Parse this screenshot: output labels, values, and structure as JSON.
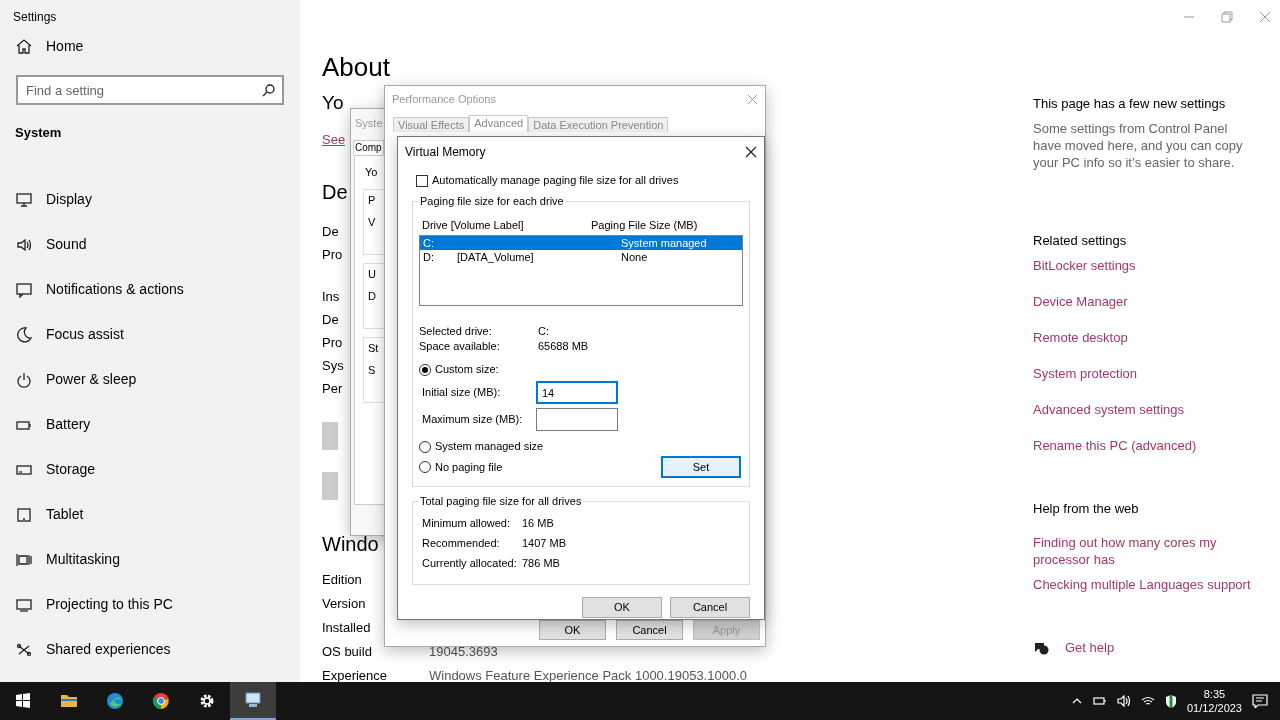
{
  "settings": {
    "title": "Settings",
    "home": "Home",
    "search": {
      "placeholder": "Find a setting"
    },
    "section": "System",
    "nav": [
      "Display",
      "Sound",
      "Notifications & actions",
      "Focus assist",
      "Power & sleep",
      "Battery",
      "Storage",
      "Tablet",
      "Multitasking",
      "Projecting to this PC",
      "Shared experiences"
    ]
  },
  "about": {
    "title": "About",
    "subtitle": "Yo",
    "link": "See",
    "device_heading": "De",
    "device_rows": [
      "De",
      "Pro",
      "Ins",
      "De",
      "Pro",
      "Sys",
      "Per"
    ],
    "windows_heading": "Windo",
    "windows_rows": [
      {
        "label": "Edition"
      },
      {
        "label": "Version"
      },
      {
        "label": "Installed"
      },
      {
        "label": "OS build",
        "value": "19045.3693"
      },
      {
        "label": "Experience",
        "value": "Windows Feature Experience Pack 1000.19053.1000.0"
      }
    ]
  },
  "side_panel": {
    "notice_title": "This page has a few new settings",
    "notice_text": "Some settings from Control Panel have moved here, and you can copy your PC info so it’s easier to share.",
    "related_heading": "Related settings",
    "related_links": [
      "BitLocker settings",
      "Device Manager",
      "Remote desktop",
      "System protection",
      "Advanced system settings",
      "Rename this PC (advanced)"
    ],
    "help_heading": "Help from the web",
    "help_links": [
      "Finding out how many cores my processor has",
      "Checking multiple Languages support"
    ],
    "get_help": "Get help"
  },
  "system_properties": {
    "title": "Syste",
    "tab": "Comp",
    "intro": "Yo",
    "groups": [
      {
        "title": "P",
        "text": "V"
      },
      {
        "title": "U",
        "text": "D"
      },
      {
        "title": "St",
        "text": "S"
      }
    ]
  },
  "performance_options": {
    "title": "Performance Options",
    "tabs": [
      {
        "label": "Visual Effects",
        "selected": false
      },
      {
        "label": "Advanced",
        "selected": true
      },
      {
        "label": "Data Execution Prevention",
        "selected": false
      }
    ],
    "buttons": [
      {
        "label": "OK",
        "disabled": false
      },
      {
        "label": "Cancel",
        "disabled": false
      },
      {
        "label": "Apply",
        "disabled": true
      }
    ]
  },
  "virtual_memory": {
    "title": "Virtual Memory",
    "auto_manage": {
      "label": "Automatically manage paging file size for all drives",
      "checked": false
    },
    "drive_group": "Paging file size for each drive",
    "columns": [
      "Drive [Volume Label]",
      "Paging File Size (MB)"
    ],
    "drives": [
      {
        "drive": "C:",
        "size": "System managed",
        "selected": true
      },
      {
        "drive": "D:",
        "label": "[DATA_Volume]",
        "size": "None",
        "selected": false
      }
    ],
    "selected_drive_label": "Selected drive:",
    "selected_drive": "C:",
    "space_label": "Space available:",
    "space": "65688 MB",
    "options": [
      {
        "label": "Custom size:",
        "selected": true
      },
      {
        "label": "System managed size",
        "selected": false
      },
      {
        "label": "No paging file",
        "selected": false
      }
    ],
    "initial_size": {
      "label": "Initial size (MB):",
      "value": "14"
    },
    "maximum_size": {
      "label": "Maximum size (MB):"
    },
    "set_button": "Set",
    "totals_group": "Total paging file size for all drives",
    "totals": [
      {
        "label": "Minimum allowed:",
        "value": "16 MB"
      },
      {
        "label": "Recommended:",
        "value": "1407 MB"
      },
      {
        "label": "Currently allocated:",
        "value": "786 MB"
      }
    ],
    "buttons": [
      "OK",
      "Cancel"
    ]
  },
  "taskbar": {
    "apps": [
      {
        "active": false
      },
      {
        "active": false
      },
      {
        "active": false
      },
      {
        "active": false
      },
      {
        "active": false
      },
      {
        "active": true
      }
    ],
    "time": "8:35",
    "date": "01/12/2023"
  }
}
